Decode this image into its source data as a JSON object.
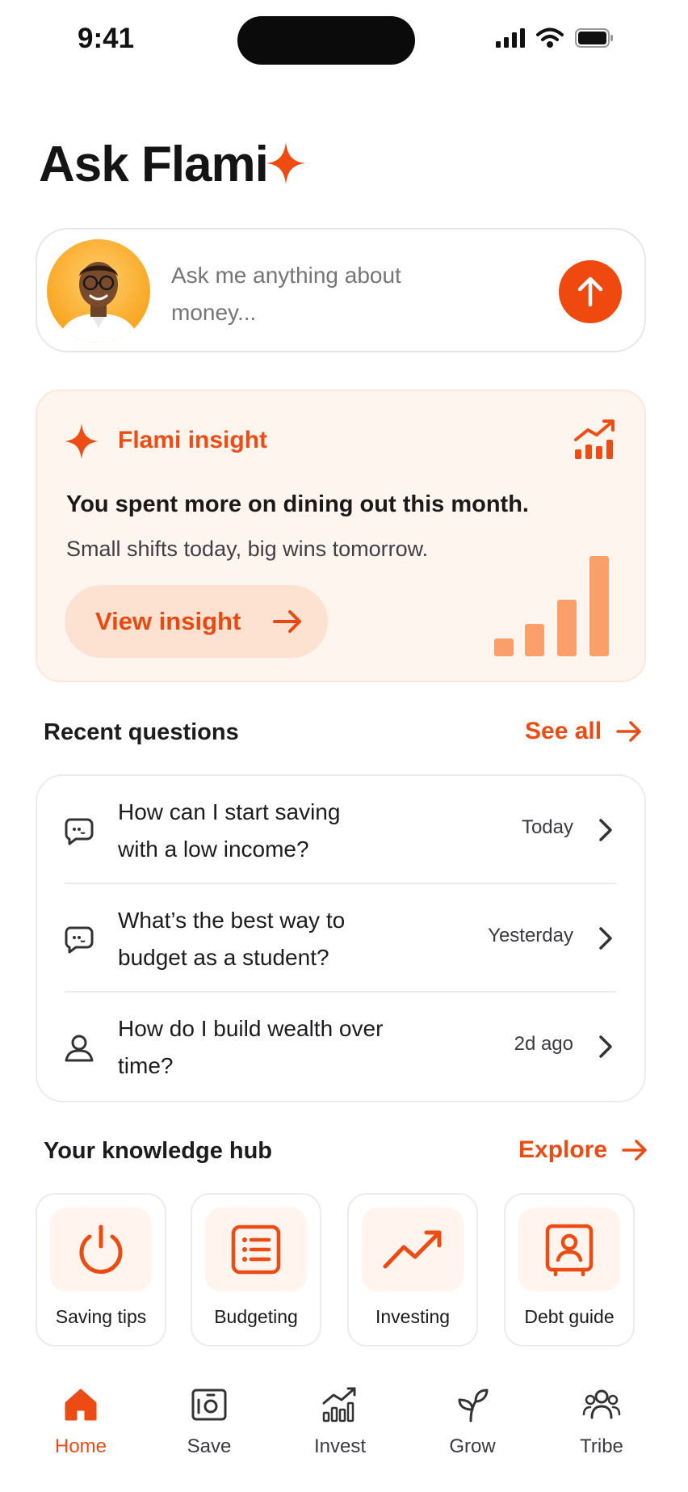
{
  "status_bar": {
    "time": "9:41"
  },
  "header": {
    "title": "Ask Flami"
  },
  "ask": {
    "placeholder": "Ask me anything about money..."
  },
  "insight": {
    "label": "Flami insight",
    "headline": "You spent more on dining out this month.",
    "subtext": "Small shifts today, big wins tomorrow.",
    "button_label": "View insight"
  },
  "recent": {
    "title": "Recent questions",
    "see_all": "See all",
    "items": [
      {
        "question": "How can I start saving with a low income?",
        "time": "Today",
        "icon": "chat-bubble-icon"
      },
      {
        "question": "What’s the best way to budget as a student?",
        "time": "Yesterday",
        "icon": "chat-bubble-icon"
      },
      {
        "question": "How do I build wealth over time?",
        "time": "2d ago",
        "icon": "person-icon"
      }
    ]
  },
  "hub": {
    "title": "Your knowledge hub",
    "explore": "Explore",
    "tiles": [
      {
        "label": "Saving tips",
        "icon": "power-coin-icon"
      },
      {
        "label": "Budgeting",
        "icon": "list-icon"
      },
      {
        "label": "Investing",
        "icon": "trend-up-icon"
      },
      {
        "label": "Debt guide",
        "icon": "contact-book-icon"
      }
    ]
  },
  "nav": {
    "items": [
      {
        "label": "Home",
        "icon": "home-icon",
        "active": true
      },
      {
        "label": "Save",
        "icon": "safe-icon"
      },
      {
        "label": "Invest",
        "icon": "chart-icon"
      },
      {
        "label": "Grow",
        "icon": "sprout-icon"
      },
      {
        "label": "Tribe",
        "icon": "people-icon"
      }
    ]
  },
  "colors": {
    "accent": "#ec4c13",
    "insight_bg": "#fff5ef",
    "bar_color": "#f9a06a"
  }
}
